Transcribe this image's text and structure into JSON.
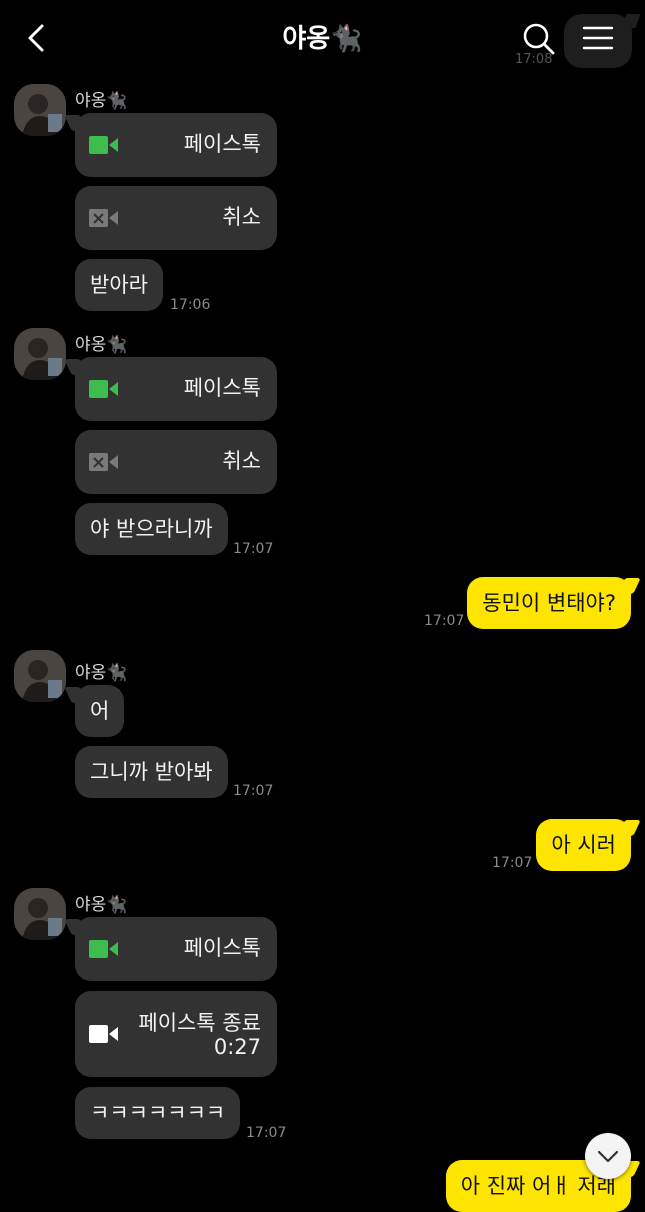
{
  "header": {
    "title": "야옹🐈‍⬛",
    "ghost_time": "17:08"
  },
  "groups": [
    {
      "name": "야옹🐈‍⬛"
    },
    {
      "name": "야옹🐈‍⬛"
    },
    {
      "name": "야옹🐈‍⬛"
    },
    {
      "name": "야옹🐈‍⬛"
    }
  ],
  "messages": {
    "g1_call": "페이스톡",
    "g1_cancel": "취소",
    "g1_text": "받아라",
    "g1_time": "17:06",
    "g2_call": "페이스톡",
    "g2_cancel": "취소",
    "g2_text": "야 받으라니까",
    "g2_time": "17:07",
    "me1_text": "동민이 변태야?",
    "me1_time": "17:07",
    "g3_text1": "어",
    "g3_text2": "그니까 받아봐",
    "g3_time": "17:07",
    "me2_text": "아 시러",
    "me2_time": "17:07",
    "g4_call": "페이스톡",
    "g4_end_label": "페이스톡 종료",
    "g4_end_duration": "0:27",
    "g4_text": "ㅋㅋㅋㅋㅋㅋㅋ",
    "g4_time": "17:07",
    "me3_text": "아 진짜 어ㅐ 저래"
  },
  "icons": {
    "back": "chevron-left-icon",
    "search": "search-icon",
    "menu": "hamburger-menu-icon",
    "video_call": "video-camera-icon",
    "video_cancel": "video-cancel-icon",
    "video_end": "video-camera-icon",
    "scroll_down": "chevron-down-icon"
  },
  "colors": {
    "background": "#000000",
    "received_bubble": "#323232",
    "sent_bubble": "#fee500",
    "call_green": "#3dbd4e",
    "timestamp": "#8a8a8a"
  }
}
